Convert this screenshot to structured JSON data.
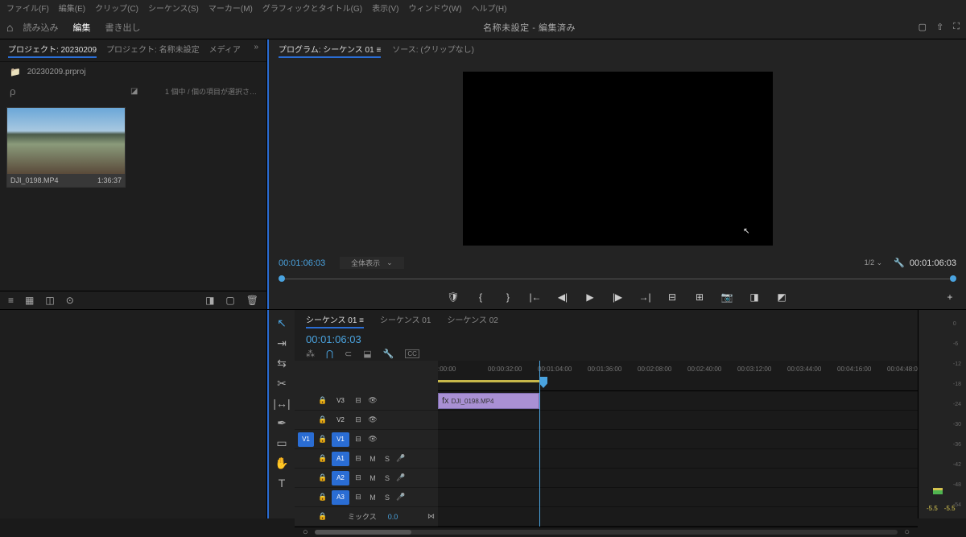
{
  "menubar": [
    "ファイル(F)",
    "編集(E)",
    "クリップ(C)",
    "シーケンス(S)",
    "マーカー(M)",
    "グラフィックとタイトル(G)",
    "表示(V)",
    "ウィンドウ(W)",
    "ヘルプ(H)"
  ],
  "topbar": {
    "modes": {
      "import": "読み込み",
      "edit": "編集",
      "export": "書き出し"
    },
    "title": "名称未設定 - 編集済み"
  },
  "project": {
    "tabs": {
      "active": "プロジェクト: 20230209",
      "second": "プロジェクト: 名称未設定",
      "media": "メディア"
    },
    "path": "20230209.prproj",
    "search_placeholder": "ρ",
    "info": "1 個中 / 個の項目が選択さ…",
    "thumb": {
      "name": "DJI_0198.MP4",
      "dur": "1:36:37"
    }
  },
  "program": {
    "tabs": {
      "active": "プログラム: シーケンス 01",
      "source": "ソース: (クリップなし)"
    },
    "tc_left": "00:01:06:03",
    "fit": "全体表示",
    "zoom": "1/2",
    "tc_right": "00:01:06:03"
  },
  "timeline": {
    "tabs": {
      "seq1": "シーケンス 01",
      "seq1b": "シーケンス 01",
      "seq2": "シーケンス 02"
    },
    "tc": "00:01:06:03",
    "ruler": [
      ":00:00",
      "00:00:32:00",
      "00:01:04:00",
      "00:01:36:00",
      "00:02:08:00",
      "00:02:40:00",
      "00:03:12:00",
      "00:03:44:00",
      "00:04:16:00",
      "00:04:48:00"
    ],
    "tracks": {
      "v3": "V3",
      "v2": "V2",
      "v1": "V1",
      "a1": "A1",
      "a2": "A2",
      "a3": "A3",
      "mix_label": "ミックス",
      "mix_val": "0.0"
    },
    "clip": "DJI_0198.MP4"
  },
  "meters": {
    "scale": [
      "0",
      "-6",
      "-12",
      "-18",
      "-24",
      "-30",
      "-36",
      "-42",
      "-48",
      "-54"
    ],
    "l1": "-5.5",
    "l2": "-5.5"
  }
}
